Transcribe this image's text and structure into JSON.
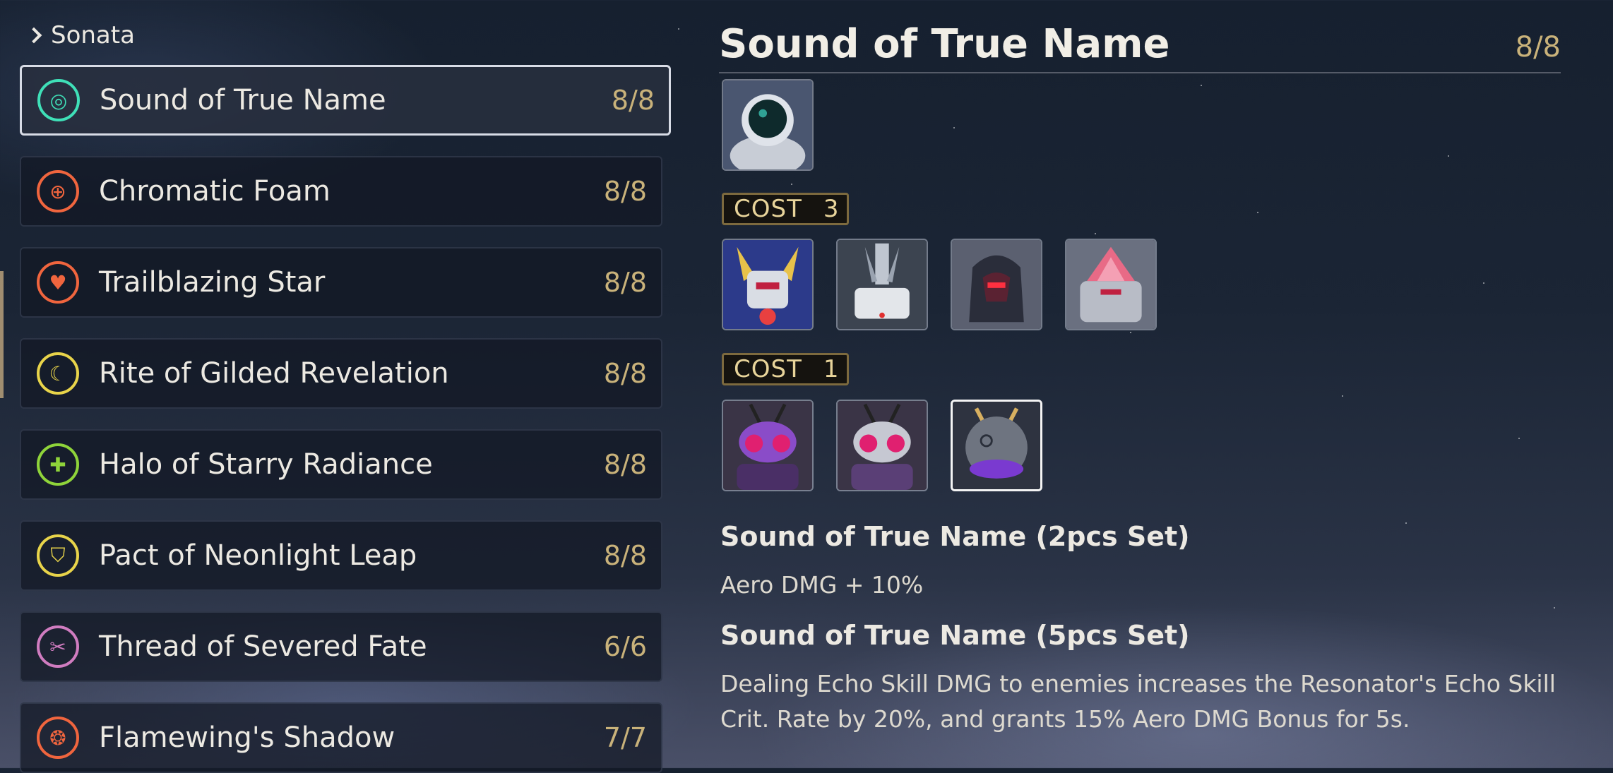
{
  "header": {
    "label": "Sonata"
  },
  "sets": [
    {
      "name": "Sound of True Name",
      "count": "8/8",
      "icon": "target-icon",
      "color": "#3fe0b8",
      "selected": true
    },
    {
      "name": "Chromatic Foam",
      "count": "8/8",
      "icon": "crosshair-icon",
      "color": "#f0653e"
    },
    {
      "name": "Trailblazing Star",
      "count": "8/8",
      "icon": "heart-icon",
      "color": "#f0653e"
    },
    {
      "name": "Rite of Gilded Revelation",
      "count": "8/8",
      "icon": "crescent-icon",
      "color": "#e8d44a"
    },
    {
      "name": "Halo of Starry Radiance",
      "count": "8/8",
      "icon": "shield-plus-icon",
      "color": "#8fd43a"
    },
    {
      "name": "Pact of Neonlight Leap",
      "count": "8/8",
      "icon": "shield-icon",
      "color": "#e8d44a"
    },
    {
      "name": "Thread of Severed Fate",
      "count": "6/6",
      "icon": "scissors-icon",
      "color": "#d07cc0"
    },
    {
      "name": "Flamewing's Shadow",
      "count": "7/7",
      "icon": "flame-icon",
      "color": "#f0653e"
    }
  ],
  "detail": {
    "title": "Sound of True Name",
    "count": "8/8",
    "cost3_label": "COST",
    "cost3_value": "3",
    "cost1_label": "COST",
    "cost1_value": "1",
    "set2_title": "Sound of True Name (2pcs Set)",
    "set2_text": "Aero DMG + 10%",
    "set5_title": "Sound of True Name (5pcs Set)",
    "set5_text": "Dealing Echo Skill DMG to enemies increases the Resonator's Echo Skill Crit. Rate by 20%, and grants 15% Aero DMG Bonus for 5s."
  },
  "echoes": {
    "cost4": [
      "astronaut-echo-icon"
    ],
    "cost3": [
      "gold-mech-echo-icon",
      "white-mech-echo-icon",
      "hooded-mech-echo-icon",
      "pink-mech-echo-icon"
    ],
    "cost1": [
      "purple-insect-echo-icon",
      "silver-insect-echo-icon",
      "orb-echo-icon"
    ]
  }
}
